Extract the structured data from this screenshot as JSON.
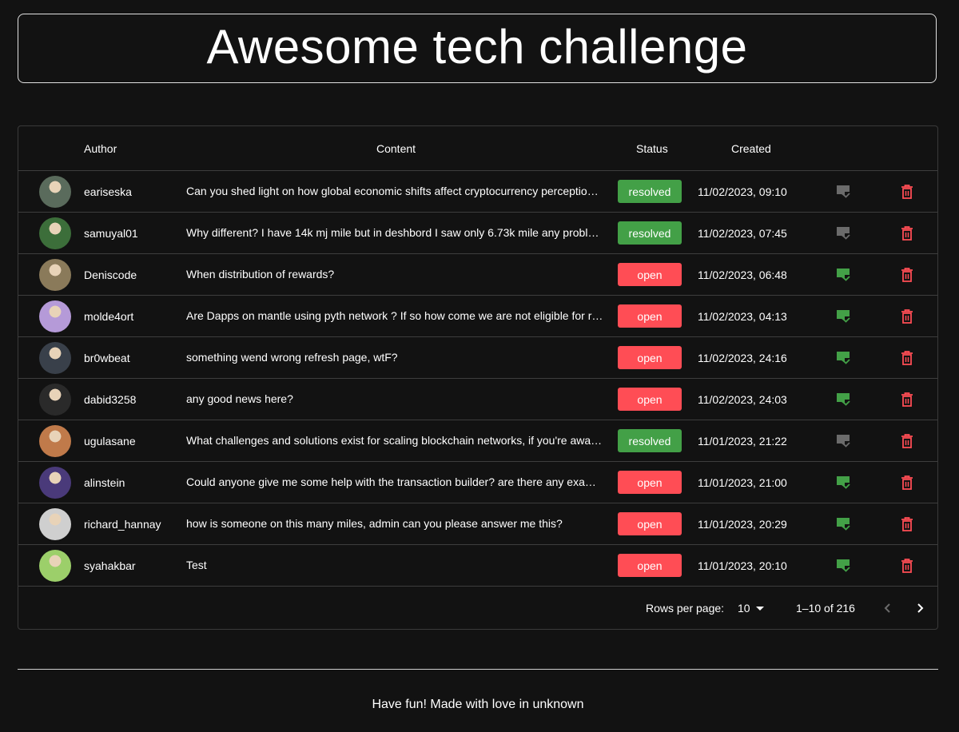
{
  "header": {
    "title": "Awesome tech challenge"
  },
  "table": {
    "columns": {
      "author": "Author",
      "content": "Content",
      "status": "Status",
      "created": "Created"
    },
    "rows": [
      {
        "author": "eariseska",
        "content": "Can you shed light on how global economic shifts affect cryptocurrency perceptions?",
        "status": "resolved",
        "created": "11/02/2023, 09:10",
        "avatar_color": "#5a6b5c"
      },
      {
        "author": "samuyal01",
        "content": "Why different? I have 14k mj mile but in deshbord I saw only 6.73k mile any problem?",
        "status": "resolved",
        "created": "11/02/2023, 07:45",
        "avatar_color": "#3c6e3a"
      },
      {
        "author": "Deniscode",
        "content": "When distribution of rewards?",
        "status": "open",
        "created": "11/02/2023, 06:48",
        "avatar_color": "#8a7a5a"
      },
      {
        "author": "molde4ort",
        "content": "Are Dapps on mantle using pyth network ? If so how come we are not eligible for rewards?",
        "status": "open",
        "created": "11/02/2023, 04:13",
        "avatar_color": "#b59ad8"
      },
      {
        "author": "br0wbeat",
        "content": "something wend wrong refresh page, wtF?",
        "status": "open",
        "created": "11/02/2023, 24:16",
        "avatar_color": "#39404a"
      },
      {
        "author": "dabid3258",
        "content": "any good news here?",
        "status": "open",
        "created": "11/02/2023, 24:03",
        "avatar_color": "#2a2a2a"
      },
      {
        "author": "ugulasane",
        "content": "What challenges and solutions exist for scaling blockchain networks, if you're aware of any?",
        "status": "resolved",
        "created": "11/01/2023, 21:22",
        "avatar_color": "#c07a4a"
      },
      {
        "author": "alinstein",
        "content": "Could anyone give me some help with the transaction builder? are there any examples?",
        "status": "open",
        "created": "11/01/2023, 21:00",
        "avatar_color": "#4a3a7a"
      },
      {
        "author": "richard_hannay",
        "content": "how is someone on this many miles, admin can you please answer me this?",
        "status": "open",
        "created": "11/01/2023, 20:29",
        "avatar_color": "#cfcfcf"
      },
      {
        "author": "syahakbar",
        "content": "Test",
        "status": "open",
        "created": "11/01/2023, 20:10",
        "avatar_color": "#9ccf6a"
      }
    ]
  },
  "pagination": {
    "rows_per_page_label": "Rows per page:",
    "rows_per_page_value": "10",
    "range_label": "1–10 of 216"
  },
  "footer": {
    "text": "Have fun! Made with love in unknown"
  },
  "colors": {
    "resolved": "#43a047",
    "open": "#ff4d55",
    "resolve_active": "#43a047",
    "resolve_disabled": "#6b6b6b",
    "delete": "#ff4d55"
  }
}
